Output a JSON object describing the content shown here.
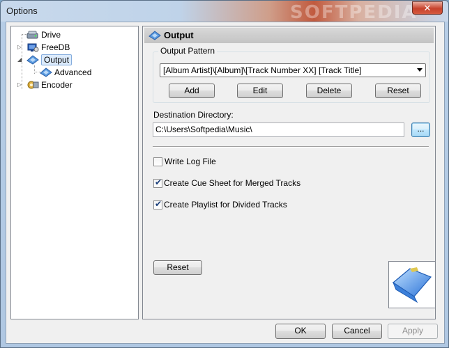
{
  "window": {
    "title": "Options",
    "watermark": "SOFTPEDIA",
    "close_label": "✕"
  },
  "tree": {
    "items": [
      {
        "label": "Drive",
        "icon": "drive-icon"
      },
      {
        "label": "FreeDB",
        "icon": "freedb-icon"
      },
      {
        "label": "Output",
        "icon": "output-icon",
        "selected": true
      },
      {
        "label": "Advanced",
        "icon": "advanced-icon"
      },
      {
        "label": "Encoder",
        "icon": "encoder-icon"
      }
    ]
  },
  "panel": {
    "title": "Output",
    "output_pattern": {
      "legend": "Output Pattern",
      "value": "[Album Artist]\\[Album]\\[Track Number XX] [Track Title]",
      "add_label": "Add",
      "edit_label": "Edit",
      "delete_label": "Delete",
      "reset_label": "Reset"
    },
    "destination": {
      "label": "Destination Directory:",
      "value": "C:\\Users\\Softpedia\\Music\\",
      "browse_label": "..."
    },
    "options": [
      {
        "label": "Write Log File",
        "checked": false
      },
      {
        "label": "Create Cue Sheet for Merged Tracks",
        "checked": true
      },
      {
        "label": "Create Playlist for Divided Tracks",
        "checked": true
      }
    ],
    "reset_label": "Reset"
  },
  "footer": {
    "ok_label": "OK",
    "cancel_label": "Cancel",
    "apply_label": "Apply"
  },
  "colors": {
    "selection": "#dcebfc",
    "accent": "#3c7fb1"
  }
}
